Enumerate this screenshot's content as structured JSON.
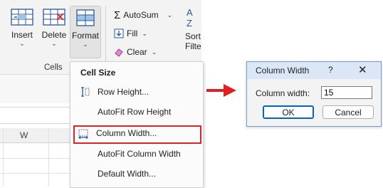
{
  "ribbon": {
    "insert_label": "Insert",
    "delete_label": "Delete",
    "format_label": "Format",
    "group_label": "Cells",
    "autosum_label": "AutoSum",
    "fill_label": "Fill",
    "clear_label": "Clear",
    "sort_label_1": "Sort",
    "sort_label_2": "Filte",
    "sort_icon_text": "AZ"
  },
  "sheet": {
    "column_header": "W"
  },
  "menu": {
    "header": "Cell Size",
    "items": [
      {
        "label": "Row Height...",
        "icon": "row-height-icon"
      },
      {
        "label": "AutoFit Row Height",
        "icon": null
      },
      {
        "label": "Column Width...",
        "icon": "column-width-icon"
      },
      {
        "label": "AutoFit Column Width",
        "icon": null
      },
      {
        "label": "Default Width...",
        "icon": null
      }
    ]
  },
  "dialog": {
    "title": "Column Width",
    "help": "?",
    "close": "✕",
    "field_label": "Column width:",
    "field_value": "15",
    "ok_label": "OK",
    "cancel_label": "Cancel"
  },
  "colors": {
    "highlight": "#d9242a",
    "arrow": "#e02020",
    "dialog_title_bg": "#dbe7f6",
    "accent": "#0067c0"
  }
}
